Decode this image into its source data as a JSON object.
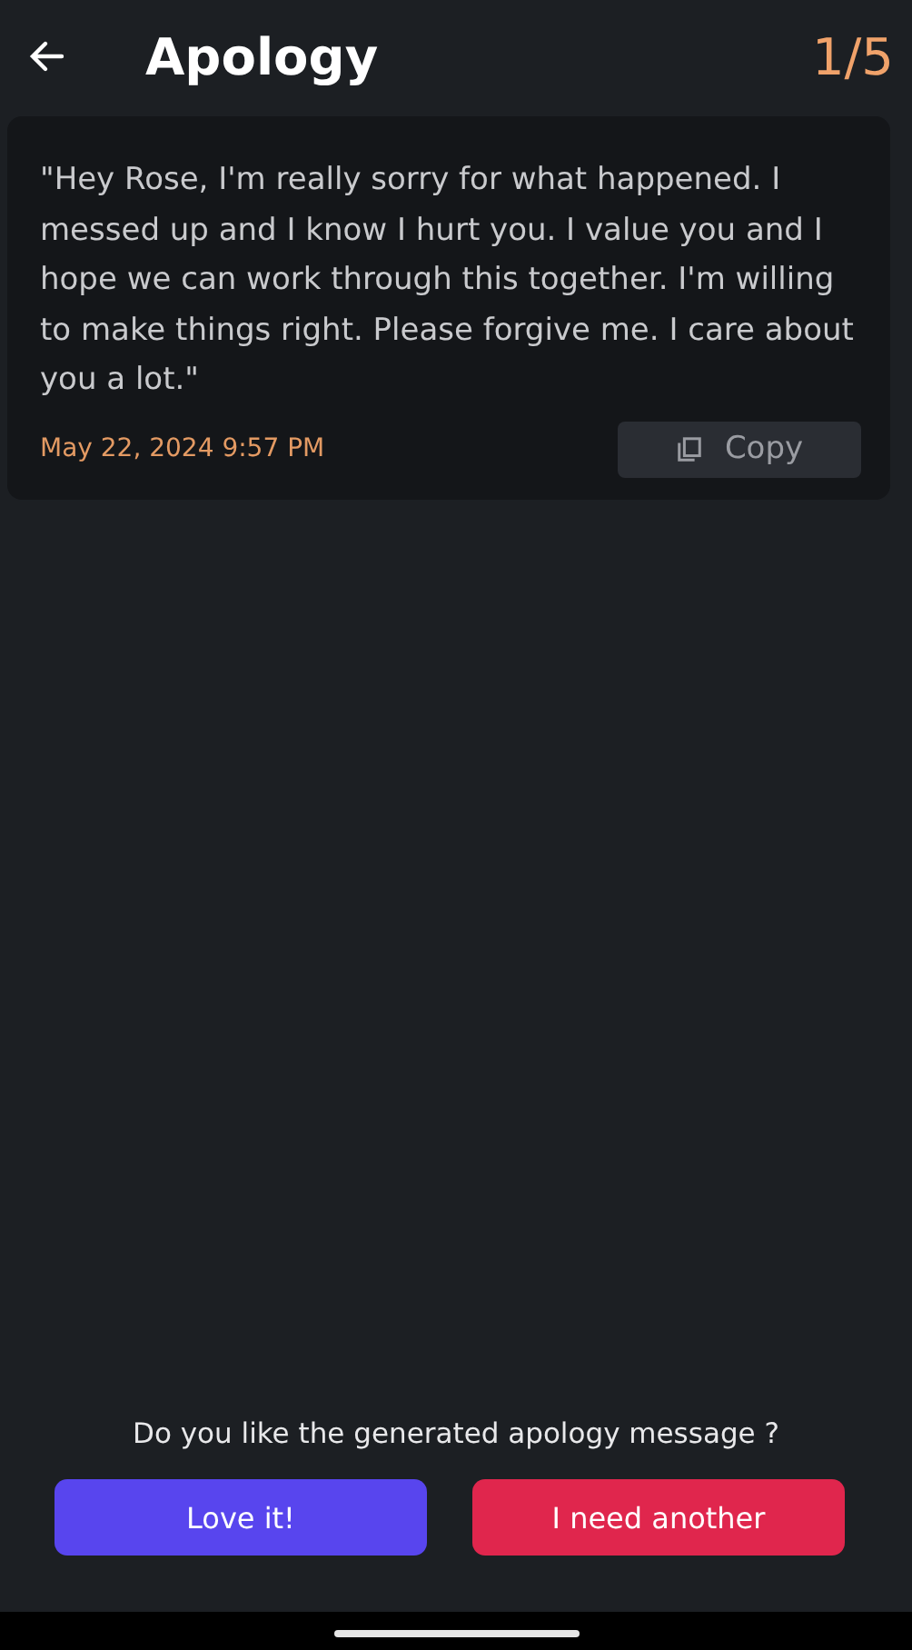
{
  "header": {
    "title": "Apology",
    "counter": "1/5"
  },
  "message": {
    "text": "\"Hey Rose, I'm really sorry for what happened. I messed up and I know I hurt you. I value you and I hope we can work through this together. I'm willing to make things right. Please forgive me. I care about you a lot.\"",
    "timestamp": "May 22, 2024 9:57 PM",
    "copy_label": "Copy"
  },
  "feedback": {
    "question": "Do you like the generated apology message ?",
    "buttons": [
      {
        "label": "Love it!",
        "kind": "primary"
      },
      {
        "label": "I need another",
        "kind": "danger"
      }
    ]
  }
}
